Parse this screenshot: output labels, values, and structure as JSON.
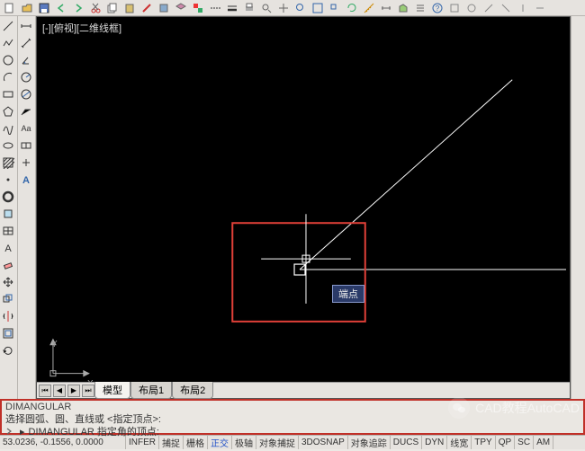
{
  "view": {
    "title": "[-][俯视][二维线框]"
  },
  "cursor_tooltip": "端点",
  "tabs": {
    "model": "模型",
    "layout1": "布局1",
    "layout2": "布局2"
  },
  "command": {
    "line1": "DIMANGULAR",
    "line2": "选择圆弧、圆、直线或 <指定顶点>:",
    "prompt_label": "DIMANGULAR 指定角的顶点:",
    "icon_name": "chevron-icon"
  },
  "status": {
    "coords": "53.0236, -0.1556, 0.0000",
    "items": [
      "INFER",
      "捕捉",
      "栅格",
      "正交",
      "极轴",
      "对象捕捉",
      "3DOSNAP",
      "对象追踪",
      "DUCS",
      "DYN",
      "线宽",
      "TPY",
      "QP",
      "SC",
      "AM"
    ]
  },
  "watermark": {
    "text": "CAD教程AutoCAD"
  },
  "ucs": {
    "x": "X",
    "y": "Y"
  },
  "colors": {
    "selection_box": "#e04038",
    "canvas_bg": "#000000",
    "line": "#ffffff"
  },
  "top_toolbar_icons": [
    "new-file-icon",
    "open-icon",
    "save-icon",
    "undo-icon",
    "redo-icon",
    "cut-icon",
    "copy-icon",
    "paste-icon",
    "match-prop-icon",
    "block-icon",
    "layer-icon",
    "color-icon",
    "linetype-icon",
    "lineweight-icon",
    "print-icon",
    "preview-icon",
    "plot-icon",
    "help-icon",
    "pan-icon",
    "zoom-icon",
    "zoom-extents-icon",
    "zoom-window-icon",
    "regen-icon",
    "measure-icon",
    "dist-icon",
    "area-icon",
    "list-icon",
    "tool-a-icon",
    "tool-b-icon",
    "tool-c-icon",
    "tool-d-icon",
    "tool-e-icon",
    "tool-f-icon"
  ],
  "left_toolbar_icons": [
    "line-icon",
    "polyline-icon",
    "rect-icon",
    "circle-icon",
    "arc-icon",
    "polygon-icon",
    "spline-icon",
    "ellipse-icon",
    "donut-icon",
    "hatch-icon",
    "point-icon",
    "erase-icon",
    "move-icon",
    "copy-icon",
    "mirror-icon",
    "offset-icon",
    "rotate-icon",
    "scale-icon",
    "trim-icon",
    "extend-icon"
  ],
  "left_toolbar2_icons": [
    "dim-linear-icon",
    "dim-aligned-icon",
    "dim-angular-icon",
    "dim-radius-icon",
    "dim-diameter-icon",
    "text-icon",
    "mtext-icon",
    "leader-icon",
    "table-icon",
    "tool-x-icon"
  ]
}
